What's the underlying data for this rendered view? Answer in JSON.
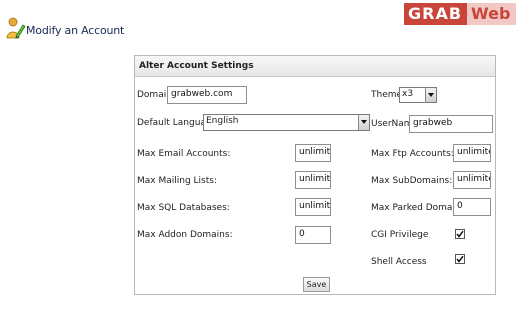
{
  "header": {
    "title": "Modify an Account",
    "icon": "user-edit-icon"
  },
  "watermark": {
    "part1": "GRAB",
    "part2": "Web"
  },
  "panel": {
    "title": "Alter Account Settings",
    "domain": {
      "label": "Domain",
      "value": "grabweb.com"
    },
    "theme": {
      "label": "Theme",
      "value": "x3"
    },
    "language": {
      "label": "Default Language",
      "value": "English"
    },
    "username": {
      "label": "UserName",
      "value": "grabweb"
    },
    "max_email": {
      "label": "Max Email Accounts:",
      "value": "unlimitec"
    },
    "max_ftp": {
      "label": "Max Ftp Accounts:",
      "value": "unlimitec"
    },
    "max_lists": {
      "label": "Max Mailing Lists:",
      "value": "unlimitec"
    },
    "max_subdomains": {
      "label": "Max SubDomains:",
      "value": "unlimitec"
    },
    "max_sql": {
      "label": "Max SQL Databases:",
      "value": "unlimitec"
    },
    "max_parked": {
      "label": "Max Parked Domains:",
      "value": "0"
    },
    "max_addon": {
      "label": "Max Addon Domains:",
      "value": "0"
    },
    "cgi": {
      "label": "CGI Privilege",
      "checked": true
    },
    "shell": {
      "label": "Shell Access",
      "checked": true
    },
    "save_label": "Save"
  }
}
